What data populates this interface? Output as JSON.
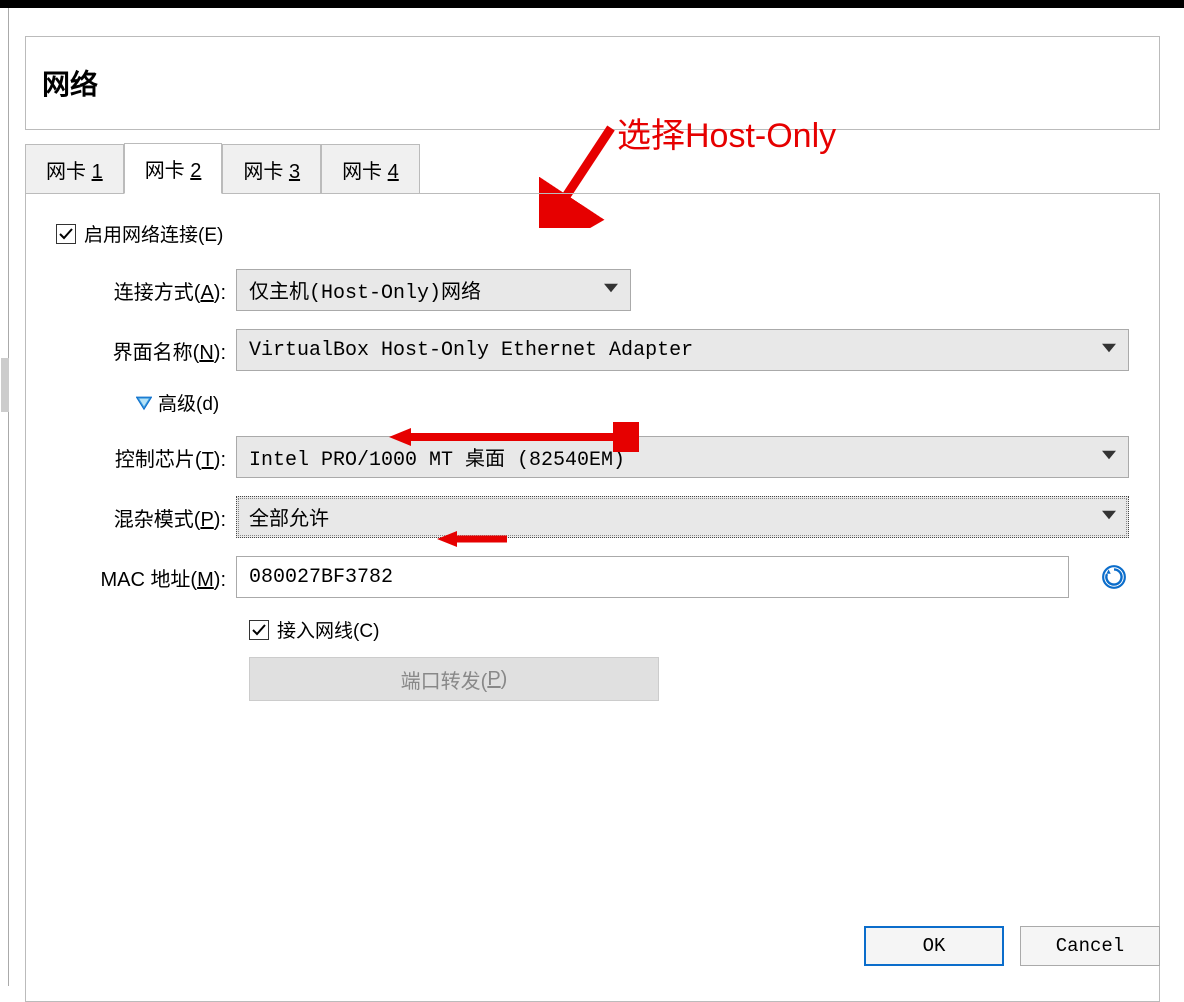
{
  "header": {
    "title": "网络"
  },
  "tabs": [
    {
      "prefix": "网卡 ",
      "key": "1"
    },
    {
      "prefix": "网卡 ",
      "key": "2"
    },
    {
      "prefix": "网卡 ",
      "key": "3"
    },
    {
      "prefix": "网卡 ",
      "key": "4"
    }
  ],
  "form": {
    "enable_label_pre": "启用网络连接(",
    "enable_label_key": "E",
    "enable_label_post": ")",
    "attach_label_pre": "连接方式(",
    "attach_label_key": "A",
    "attach_label_post": "):",
    "attach_value": "仅主机(Host-Only)网络",
    "name_label_pre": "界面名称(",
    "name_label_key": "N",
    "name_label_post": "):",
    "name_value": "VirtualBox Host-Only Ethernet Adapter",
    "advanced_pre": "高级(",
    "advanced_key": "d",
    "advanced_post": ")",
    "chip_label_pre": "控制芯片(",
    "chip_label_key": "T",
    "chip_label_post": "):",
    "chip_value": "Intel PRO/1000 MT 桌面 (82540EM)",
    "promisc_label_pre": "混杂模式(",
    "promisc_label_key": "P",
    "promisc_label_post": "):",
    "promisc_value": "全部允许",
    "mac_label_pre": "MAC 地址(",
    "mac_label_key": "M",
    "mac_label_post": "):",
    "mac_value": "080027BF3782",
    "cable_pre": "接入网线(",
    "cable_key": "C",
    "cable_post": ")",
    "port_forward_pre": "端口转发(",
    "port_forward_key": "P",
    "port_forward_post": ")"
  },
  "annotation": {
    "text": "选择Host-Only"
  },
  "footer": {
    "ok": "OK",
    "cancel": "Cancel"
  }
}
